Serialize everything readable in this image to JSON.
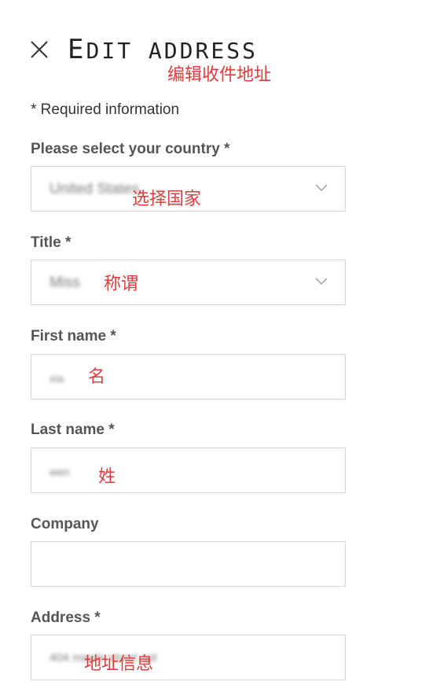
{
  "header": {
    "title_initial": "E",
    "title_rest": "DIT ADDRESS",
    "close_icon": "close-icon"
  },
  "annotations": {
    "title_cn": "编辑收件地址",
    "country_cn": "选择国家",
    "title_field_cn": "称谓",
    "first_name_cn": "名",
    "last_name_cn": "姓",
    "address_cn": "地址信息"
  },
  "form": {
    "required_note": "* Required information",
    "country": {
      "label": "Please select your country *",
      "value": "United States",
      "icon": "chevron-down-icon"
    },
    "title": {
      "label": "Title *",
      "value": "Miss",
      "icon": "chevron-down-icon"
    },
    "first_name": {
      "label": "First name *",
      "value": "xia"
    },
    "last_name": {
      "label": "Last name *",
      "value": "wen"
    },
    "company": {
      "label": "Company",
      "value": ""
    },
    "address": {
      "label": "Address *",
      "value": "404 maple street apt"
    }
  },
  "colors": {
    "annotation": "#e23b3b",
    "border": "#d8d8d8",
    "label": "#555555"
  }
}
